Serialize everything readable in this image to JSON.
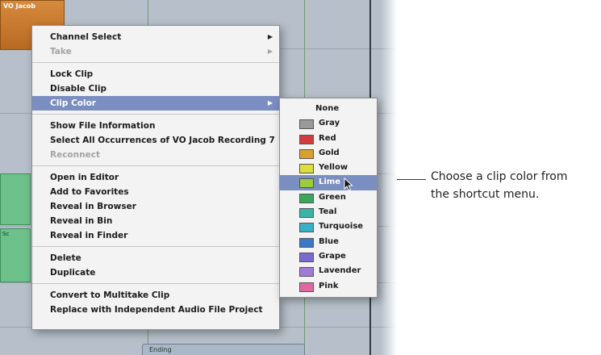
{
  "timeline": {
    "clip_top_label": "VO Jacob",
    "clip_green_label": "Sc",
    "clip_bottom_label": "Ending"
  },
  "context_menu": {
    "groups": [
      [
        {
          "label": "Channel Select",
          "submenu": true,
          "enabled": true
        },
        {
          "label": "Take",
          "submenu": true,
          "enabled": false
        }
      ],
      [
        {
          "label": "Lock Clip",
          "enabled": true
        },
        {
          "label": "Disable Clip",
          "enabled": true
        },
        {
          "label": "Clip Color",
          "submenu": true,
          "enabled": true,
          "highlighted": true
        }
      ],
      [
        {
          "label": "Show File Information",
          "enabled": true
        },
        {
          "label": "Select All Occurrences of VO Jacob Recording 7",
          "enabled": true
        },
        {
          "label": "Reconnect",
          "enabled": false
        }
      ],
      [
        {
          "label": "Open in Editor",
          "enabled": true
        },
        {
          "label": "Add to Favorites",
          "enabled": true
        },
        {
          "label": "Reveal in Browser",
          "enabled": true
        },
        {
          "label": "Reveal in Bin",
          "enabled": true
        },
        {
          "label": "Reveal in Finder",
          "enabled": true
        }
      ],
      [
        {
          "label": "Delete",
          "enabled": true
        },
        {
          "label": "Duplicate",
          "enabled": true
        }
      ],
      [
        {
          "label": "Convert to Multitake Clip",
          "enabled": true
        },
        {
          "label": "Replace with Independent Audio File Project",
          "enabled": true
        }
      ]
    ]
  },
  "clip_colors": [
    {
      "label": "None",
      "color": null
    },
    {
      "label": "Gray",
      "color": "#9a9a9a"
    },
    {
      "label": "Red",
      "color": "#d23c3c"
    },
    {
      "label": "Gold",
      "color": "#d9a030"
    },
    {
      "label": "Yellow",
      "color": "#dede3a"
    },
    {
      "label": "Lime",
      "color": "#9acd3c",
      "highlighted": true
    },
    {
      "label": "Green",
      "color": "#3aa85a"
    },
    {
      "label": "Teal",
      "color": "#3ab5a5"
    },
    {
      "label": "Turquoise",
      "color": "#38b0c8"
    },
    {
      "label": "Blue",
      "color": "#3c78c8"
    },
    {
      "label": "Grape",
      "color": "#7a6ad0"
    },
    {
      "label": "Lavender",
      "color": "#a07ad8"
    },
    {
      "label": "Pink",
      "color": "#e06aa0"
    }
  ],
  "annotation": {
    "line1": "Choose a clip color from",
    "line2": "the shortcut menu."
  },
  "icons": {
    "submenu_arrow": "▶",
    "cursor": "pointer-arrow-icon"
  }
}
